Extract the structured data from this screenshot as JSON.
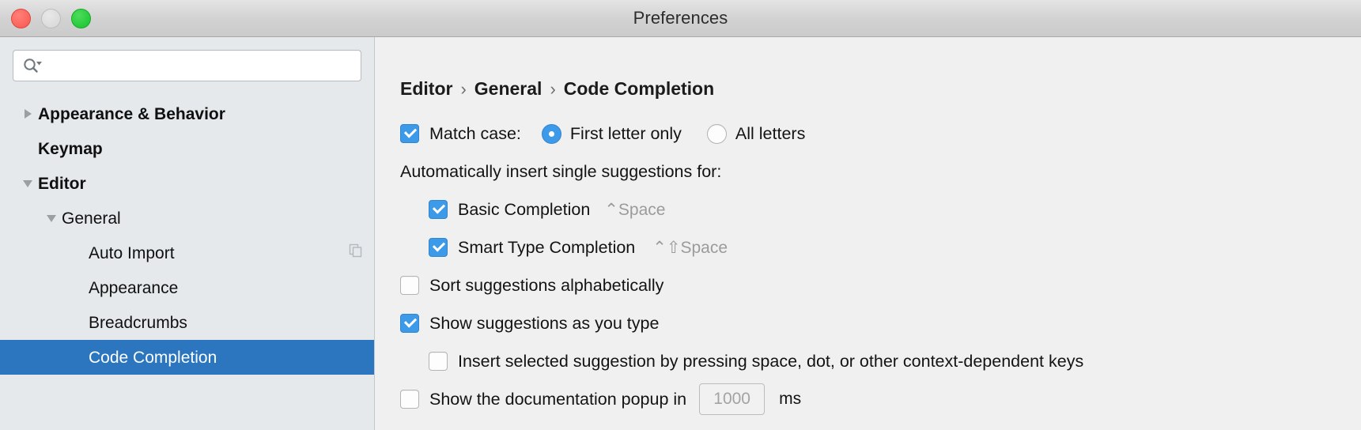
{
  "window": {
    "title": "Preferences",
    "traffic_lights": [
      "close-button",
      "minimize-button",
      "maximize-button"
    ]
  },
  "colors": {
    "selection_blue": "#2b76bf",
    "control_blue": "#3d9ae8",
    "sidebar_bg": "#e5e9ec",
    "main_bg": "#f0f0f0",
    "titlebar_bg": "#d2d2d2",
    "shortcut_gray": "#9b9b9b",
    "placeholder_gray": "#a3a3a3"
  },
  "sidebar": {
    "search": {
      "value": "",
      "placeholder": "",
      "icon": "search-icon",
      "dropdown_icon": "chevron-down-icon"
    },
    "items": [
      {
        "label": "Appearance & Behavior",
        "level": 0,
        "twisty": "collapsed",
        "bold": true,
        "selected": false,
        "badge": null
      },
      {
        "label": "Keymap",
        "level": 0,
        "twisty": "none",
        "bold": true,
        "selected": false,
        "badge": null
      },
      {
        "label": "Editor",
        "level": 0,
        "twisty": "expanded",
        "bold": true,
        "selected": false,
        "badge": null
      },
      {
        "label": "General",
        "level": 1,
        "twisty": "expanded",
        "bold": false,
        "selected": false,
        "badge": null
      },
      {
        "label": "Auto Import",
        "level": 2,
        "twisty": "none",
        "bold": false,
        "selected": false,
        "badge": "copy-icon"
      },
      {
        "label": "Appearance",
        "level": 2,
        "twisty": "none",
        "bold": false,
        "selected": false,
        "badge": null
      },
      {
        "label": "Breadcrumbs",
        "level": 2,
        "twisty": "none",
        "bold": false,
        "selected": false,
        "badge": null
      },
      {
        "label": "Code Completion",
        "level": 2,
        "twisty": "none",
        "bold": false,
        "selected": true,
        "badge": null
      }
    ]
  },
  "main": {
    "breadcrumb": {
      "crumbs": [
        "Editor",
        "General",
        "Code Completion"
      ],
      "separator": "›"
    },
    "match_case": {
      "label": "Match case:",
      "checked": true,
      "options": [
        {
          "label": "First letter only",
          "selected": true
        },
        {
          "label": "All letters",
          "selected": false
        }
      ]
    },
    "auto_insert_group": {
      "label": "Automatically insert single suggestions for:",
      "items": [
        {
          "label": "Basic Completion",
          "checked": true,
          "shortcut": "⌃Space"
        },
        {
          "label": "Smart Type Completion",
          "checked": true,
          "shortcut": "⌃⇧Space"
        }
      ]
    },
    "options": [
      {
        "label": "Sort suggestions alphabetically",
        "checked": false,
        "indent": 0
      },
      {
        "label": "Show suggestions as you type",
        "checked": true,
        "indent": 0
      },
      {
        "label": "Insert selected suggestion by pressing space, dot, or other context-dependent keys",
        "checked": false,
        "indent": 1
      }
    ],
    "doc_popup": {
      "label": "Show the documentation popup in",
      "checked": false,
      "delay_value": "1000",
      "delay_placeholder": "1000",
      "unit": "ms"
    }
  }
}
